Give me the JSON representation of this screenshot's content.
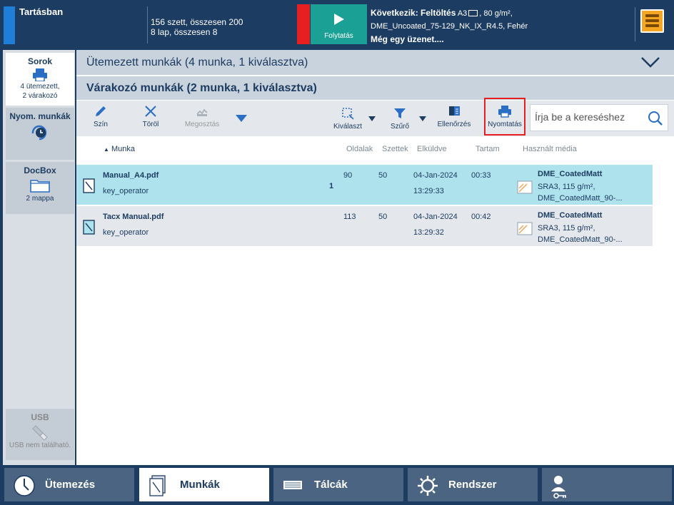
{
  "top": {
    "status": "Tartásban",
    "counts_line1": "156 szett, összesen 200",
    "counts_line2": "8 lap, összesen 8",
    "continue_label": "Folytatás",
    "next_prefix": "Következik: Feltöltés",
    "next_size": "A3",
    "next_weight": ", 80 g/m²,",
    "next_media": "DME_Uncoated_75-129_NK_IX_R4.5, Fehér",
    "more_message": "Még egy üzenet....",
    "colors": {
      "status": "#1f7fd8",
      "alert": "#e62020",
      "continue": "#1aa094",
      "menu": "#f5a623"
    }
  },
  "leftnav": {
    "sorok": {
      "title": "Sorok",
      "line1": "4 ütemezett,",
      "line2": "2 várakozó"
    },
    "nyom": {
      "title": "Nyom. munkák"
    },
    "docbox": {
      "title": "DocBox",
      "sub": "2 mappa"
    },
    "usb": {
      "title": "USB",
      "sub": "USB nem található."
    }
  },
  "main": {
    "scheduled_title": "Ütemezett munkák (4 munka, 1 kiválasztva)",
    "waiting_title": "Várakozó munkák (2 munka, 1 kiválasztva)",
    "toolbar": {
      "color": "Szín",
      "delete": "Töröl",
      "share": "Megosztás",
      "select": "Kiválaszt",
      "filter": "Szűrő",
      "check": "Ellenőrzés",
      "print": "Nyomtatás"
    },
    "search_placeholder": "Írja be a kereséshez",
    "columns": {
      "job": "Munka",
      "pages": "Oldalak",
      "sets": "Szettek",
      "sent": "Elküldve",
      "duration": "Tartam",
      "media": "Használt média"
    },
    "rows": [
      {
        "name": "Manual_A4.pdf",
        "owner": "key_operator",
        "pages": "90",
        "sets": "50",
        "count": "1",
        "date": "04-Jan-2024",
        "time": "13:29:33",
        "duration": "00:33",
        "media_name": "DME_CoatedMatt",
        "media_line2": "SRA3, 115 g/m²,",
        "media_line3": "DME_CoatedMatt_90-..."
      },
      {
        "name": "Tacx Manual.pdf",
        "owner": "key_operator",
        "pages": "113",
        "sets": "50",
        "count": "",
        "date": "04-Jan-2024",
        "time": "13:29:32",
        "duration": "00:42",
        "media_name": "DME_CoatedMatt",
        "media_line2": "SRA3, 115 g/m²,",
        "media_line3": "DME_CoatedMatt_90-..."
      }
    ]
  },
  "bottom": {
    "schedule": "Ütemezés",
    "jobs": "Munkák",
    "trays": "Tálcák",
    "system": "Rendszer"
  }
}
